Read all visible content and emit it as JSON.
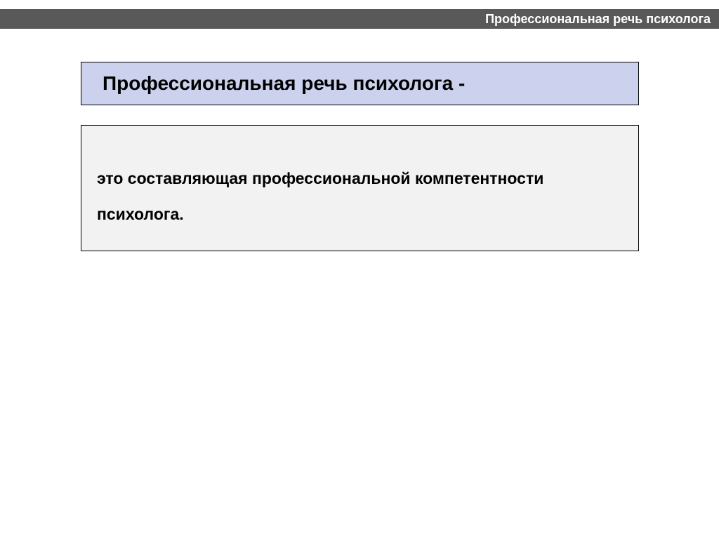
{
  "header": {
    "label": "Профессиональная речь психолога"
  },
  "title": {
    "text": "Профессиональная речь психолога -"
  },
  "content": {
    "text": "это составляющая профессиональной компетентности психолога."
  }
}
